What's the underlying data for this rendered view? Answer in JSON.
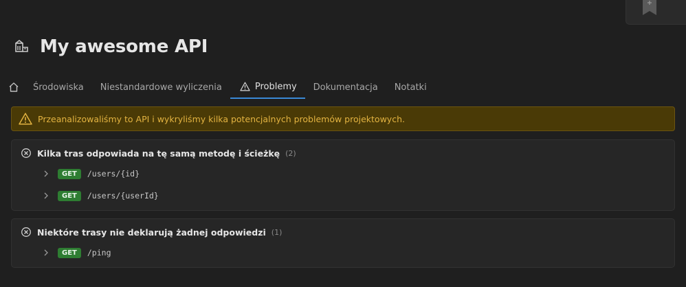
{
  "app": {
    "title": "My awesome API"
  },
  "tabs": [
    {
      "label": "",
      "icon": "home-icon"
    },
    {
      "label": "Środowiska"
    },
    {
      "label": "Niestandardowe wyliczenia"
    },
    {
      "label": "Problemy",
      "icon": "warning-icon",
      "active": true
    },
    {
      "label": "Dokumentacja"
    },
    {
      "label": "Notatki"
    }
  ],
  "alert": {
    "text": "Przeanalizowaliśmy to API i wykryliśmy kilka potencjalnych problemów projektowych.",
    "icon": "warning-icon"
  },
  "issues": [
    {
      "title": "Kilka tras odpowiada na tę samą metodę i ścieżkę",
      "count": "(2)",
      "icon": "error-circle-icon",
      "routes": [
        {
          "method": "GET",
          "path": "/users/{id}"
        },
        {
          "method": "GET",
          "path": "/users/{userId}"
        }
      ]
    },
    {
      "title": "Niektóre trasy nie deklarują żadnej odpowiedzi",
      "count": "(1)",
      "icon": "error-circle-icon",
      "routes": [
        {
          "method": "GET",
          "path": "/ping"
        }
      ]
    }
  ],
  "colors": {
    "background": "#1f1f1f",
    "accent": "#3a8ad8",
    "warning_bg": "#4a3a06",
    "warning_text": "#e3b341",
    "get_badge": "#2e7d32"
  }
}
